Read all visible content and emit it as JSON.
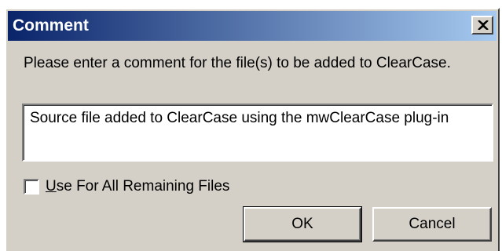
{
  "dialog": {
    "title": "Comment",
    "close_glyph": "✕",
    "prompt": "Please enter a comment for the file(s) to be added to ClearCase.",
    "comment_value": "Source file added to ClearCase using the mwClearCase plug-in",
    "checkbox": {
      "mnemonic": "U",
      "rest": "se For All Remaining Files",
      "checked": false
    },
    "buttons": {
      "ok": "OK",
      "cancel": "Cancel"
    }
  },
  "colors": {
    "title_gradient_start": "#0a246a",
    "title_gradient_end": "#a6caf0",
    "face": "#d4d0c8"
  },
  "icons": {
    "close": "close-icon"
  }
}
